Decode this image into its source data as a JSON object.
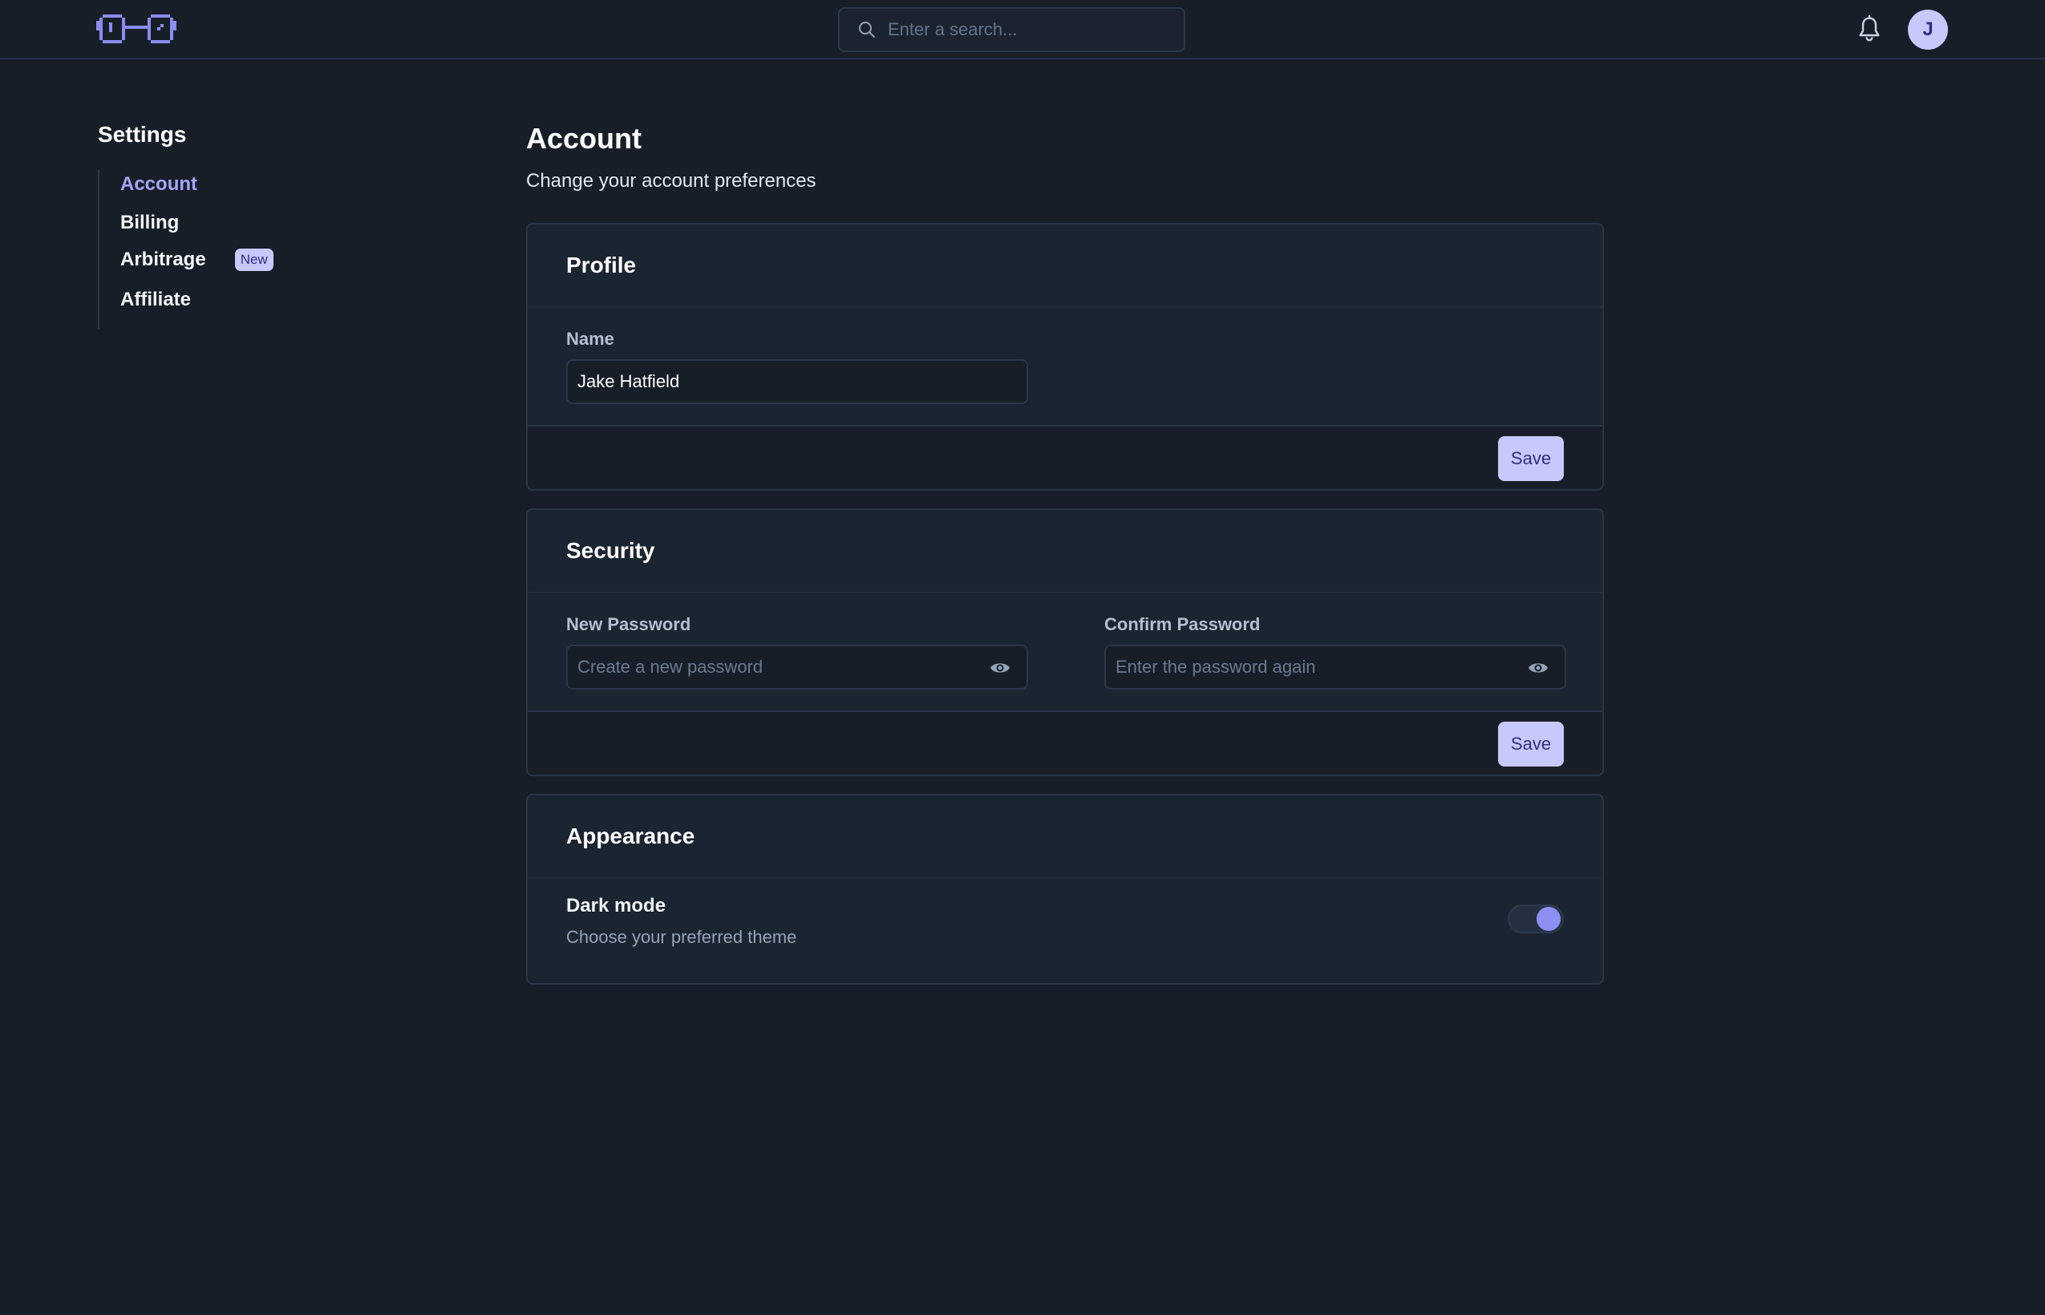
{
  "header": {
    "logo_icon": "pixel-glasses-logo",
    "search": {
      "placeholder": "Enter a search...",
      "icon": "search-icon"
    },
    "notifications_icon": "bell-icon",
    "avatar_initial": "J"
  },
  "sidebar": {
    "title": "Settings",
    "items": [
      {
        "label": "Account",
        "active": true
      },
      {
        "label": "Billing",
        "active": false
      },
      {
        "label": "Arbitrage",
        "active": false,
        "badge": "New"
      },
      {
        "label": "Affiliate",
        "active": false
      }
    ]
  },
  "main": {
    "title": "Account",
    "subtitle": "Change your account preferences",
    "profile": {
      "heading": "Profile",
      "name_label": "Name",
      "name_value": "Jake Hatfield",
      "save_label": "Save"
    },
    "security": {
      "heading": "Security",
      "new_password_label": "New Password",
      "new_password_placeholder": "Create a new password",
      "confirm_password_label": "Confirm Password",
      "confirm_password_placeholder": "Enter the password again",
      "save_label": "Save"
    },
    "appearance": {
      "heading": "Appearance",
      "dark_mode_title": "Dark mode",
      "dark_mode_desc": "Choose your preferred theme",
      "dark_mode_enabled": true
    }
  },
  "colors": {
    "background": "#171e28",
    "card": "#1b2431",
    "accent": "#a5a6f6",
    "button": "#c7c8fb",
    "button_text": "#312e81"
  }
}
